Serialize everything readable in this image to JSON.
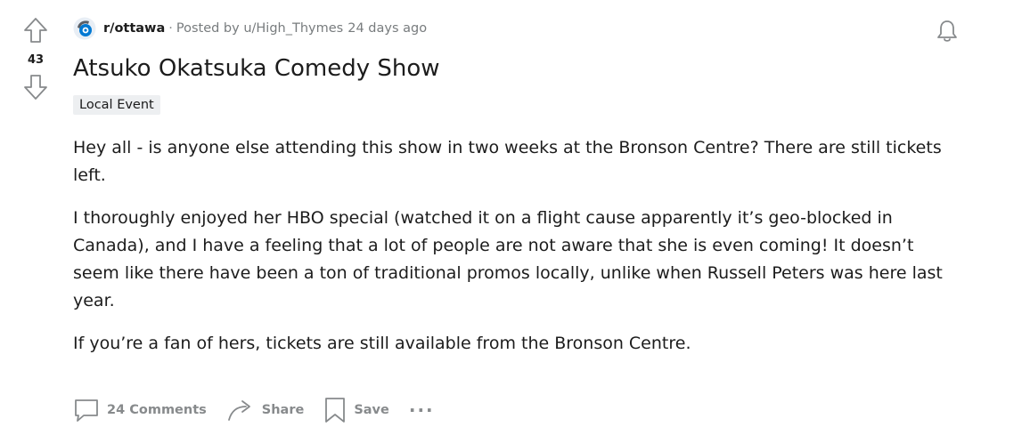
{
  "vote": {
    "count": "43"
  },
  "post": {
    "subreddit": "r/ottawa",
    "separator": "·",
    "posted_by": "Posted by",
    "author": "u/High_Thymes",
    "time": "24 days ago",
    "title": "Atsuko Okatsuka Comedy Show",
    "flair": "Local Event",
    "paragraphs": [
      "Hey all - is anyone else attending this show in two weeks at the Bronson Centre? There are still tickets left.",
      "I thoroughly enjoyed her HBO special (watched it on a flight cause apparently it’s geo-blocked in Canada), and I have a feeling that a lot of people are not aware that she is even coming! It doesn’t seem like there have been a ton of traditional promos locally, unlike when Russell Peters was here last year.",
      "If you’re a fan of hers, tickets are still available from the Bronson Centre."
    ]
  },
  "actions": {
    "comments": "24 Comments",
    "share": "Share",
    "save": "Save",
    "more": "···"
  },
  "icons": {
    "upvote": "upvote-arrow-icon",
    "downvote": "downvote-arrow-icon",
    "subreddit": "subreddit-avatar-icon",
    "bell": "notification-bell-icon",
    "comment": "comment-bubble-icon",
    "share": "share-arrow-icon",
    "save": "bookmark-icon"
  },
  "colors": {
    "text": "#1c1c1c",
    "muted": "#878a8c",
    "flair_bg": "#edeff1",
    "avatar_blue": "#0079d3"
  }
}
